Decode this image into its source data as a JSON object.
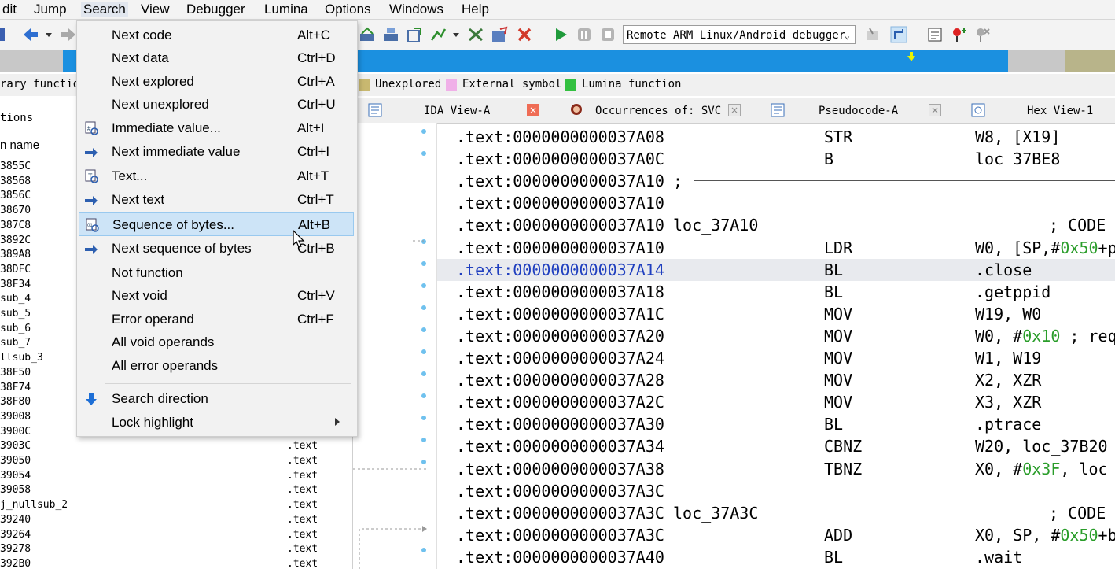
{
  "menubar": [
    "dit",
    "Jump",
    "Search",
    "View",
    "Debugger",
    "Lumina",
    "Options",
    "Windows",
    "Help"
  ],
  "toolbar": {
    "debugger": "Remote ARM Linux/Android debugger"
  },
  "legend": [
    {
      "label": "Unexplored",
      "color": "#c8b870"
    },
    {
      "label": "External symbol",
      "color": "#f0b0e8"
    },
    {
      "label": "Lumina function",
      "color": "#33c040"
    }
  ],
  "left_panel": {
    "title_partial": "rary functio",
    "header_partial": "tions",
    "column_name": "n name",
    "rows": [
      {
        "name": "3855C",
        "seg": ""
      },
      {
        "name": "38568",
        "seg": ""
      },
      {
        "name": "3856C",
        "seg": ""
      },
      {
        "name": "38670",
        "seg": ""
      },
      {
        "name": "387C8",
        "seg": ""
      },
      {
        "name": "3892C",
        "seg": ""
      },
      {
        "name": "389A8",
        "seg": ""
      },
      {
        "name": "38DFC",
        "seg": ""
      },
      {
        "name": "38F34",
        "seg": ""
      },
      {
        "name": "sub_4",
        "seg": ""
      },
      {
        "name": "sub_5",
        "seg": ""
      },
      {
        "name": "sub_6",
        "seg": ""
      },
      {
        "name": "sub_7",
        "seg": ""
      },
      {
        "name": "llsub_3",
        "seg": ""
      },
      {
        "name": "38F50",
        "seg": ""
      },
      {
        "name": "38F74",
        "seg": ""
      },
      {
        "name": "38F80",
        "seg": ""
      },
      {
        "name": "39008",
        "seg": ""
      },
      {
        "name": "3900C",
        "seg": ""
      },
      {
        "name": "3903C",
        "seg": ".text"
      },
      {
        "name": "39050",
        "seg": ".text"
      },
      {
        "name": "39054",
        "seg": ".text"
      },
      {
        "name": "39058",
        "seg": ".text"
      },
      {
        "name": "j_nullsub_2",
        "seg": ".text"
      },
      {
        "name": "39240",
        "seg": ".text"
      },
      {
        "name": "39264",
        "seg": ".text"
      },
      {
        "name": "39278",
        "seg": ".text"
      },
      {
        "name": "392B0",
        "seg": ".text"
      }
    ]
  },
  "tabs": [
    {
      "label": "IDA View-A"
    },
    {
      "label": "Occurrences of: SVC"
    },
    {
      "label": "Pseudocode-A"
    },
    {
      "label": "Hex View-1"
    }
  ],
  "search_menu": {
    "items": [
      {
        "label": "Next code",
        "shortcut": "Alt+C",
        "icon": ""
      },
      {
        "label": "Next data",
        "shortcut": "Ctrl+D",
        "icon": ""
      },
      {
        "label": "Next explored",
        "shortcut": "Ctrl+A",
        "icon": ""
      },
      {
        "label": "Next unexplored",
        "shortcut": "Ctrl+U",
        "icon": ""
      },
      {
        "label": "Immediate value...",
        "shortcut": "Alt+I",
        "icon": "immediate-value-icon"
      },
      {
        "label": "Next immediate value",
        "shortcut": "Ctrl+I",
        "icon": "next-immediate-icon"
      },
      {
        "label": "Text...",
        "shortcut": "Alt+T",
        "icon": "text-search-icon"
      },
      {
        "label": "Next text",
        "shortcut": "Ctrl+T",
        "icon": "next-text-icon"
      },
      {
        "label": "Sequence of bytes...",
        "shortcut": "Alt+B",
        "icon": "byte-sequence-icon",
        "selected": true
      },
      {
        "label": "Next sequence of bytes",
        "shortcut": "Ctrl+B",
        "icon": "next-byte-sequence-icon"
      },
      {
        "label": "Not function",
        "shortcut": "",
        "icon": ""
      },
      {
        "label": "Next void",
        "shortcut": "Ctrl+V",
        "icon": ""
      },
      {
        "label": "Error operand",
        "shortcut": "Ctrl+F",
        "icon": ""
      },
      {
        "label": "All void operands",
        "shortcut": "",
        "icon": ""
      },
      {
        "label": "All error operands",
        "shortcut": "",
        "icon": ""
      }
    ],
    "extra": [
      {
        "label": "Search direction",
        "icon": "arrow-down-icon"
      },
      {
        "label": "Lock highlight",
        "submenu": true
      }
    ]
  },
  "disasm": [
    {
      "addr": ".text:0000000000037A08",
      "label": "",
      "mnem": "STR",
      "ops": "W8, [X19]"
    },
    {
      "addr": ".text:0000000000037A0C",
      "label": "",
      "mnem": "B",
      "ops": "loc_37BE8"
    },
    {
      "addr": ".text:0000000000037A10",
      "label": ";",
      "mnem": "",
      "ops": "",
      "separator": true
    },
    {
      "addr": ".text:0000000000037A10",
      "label": "",
      "mnem": "",
      "ops": ""
    },
    {
      "addr": ".text:0000000000037A10",
      "label": "loc_37A10",
      "mnem": "",
      "ops": "",
      "comment": "; CODE"
    },
    {
      "addr": ".text:0000000000037A10",
      "label": "",
      "mnem": "LDR",
      "ops": "W0, [SP,#0x50+p"
    },
    {
      "addr": ".text:0000000000037A14",
      "label": "",
      "mnem": "BL",
      "ops": ".close",
      "highlight": true
    },
    {
      "addr": ".text:0000000000037A18",
      "label": "",
      "mnem": "BL",
      "ops": ".getppid"
    },
    {
      "addr": ".text:0000000000037A1C",
      "label": "",
      "mnem": "MOV",
      "ops": "W19, W0"
    },
    {
      "addr": ".text:0000000000037A20",
      "label": "",
      "mnem": "MOV",
      "ops": "W0, #0x10 ; req"
    },
    {
      "addr": ".text:0000000000037A24",
      "label": "",
      "mnem": "MOV",
      "ops": "W1, W19"
    },
    {
      "addr": ".text:0000000000037A28",
      "label": "",
      "mnem": "MOV",
      "ops": "X2, XZR"
    },
    {
      "addr": ".text:0000000000037A2C",
      "label": "",
      "mnem": "MOV",
      "ops": "X3, XZR"
    },
    {
      "addr": ".text:0000000000037A30",
      "label": "",
      "mnem": "BL",
      "ops": ".ptrace"
    },
    {
      "addr": ".text:0000000000037A34",
      "label": "",
      "mnem": "CBNZ",
      "ops": "W20, loc_37B20"
    },
    {
      "addr": ".text:0000000000037A38",
      "label": "",
      "mnem": "TBNZ",
      "ops": "X0, #0x3F, loc_"
    },
    {
      "addr": ".text:0000000000037A3C",
      "label": "",
      "mnem": "",
      "ops": ""
    },
    {
      "addr": ".text:0000000000037A3C",
      "label": "loc_37A3C",
      "mnem": "",
      "ops": "",
      "comment": "; CODE"
    },
    {
      "addr": ".text:0000000000037A3C",
      "label": "",
      "mnem": "ADD",
      "ops": "X0, SP, #0x50+b"
    },
    {
      "addr": ".text:0000000000037A40",
      "label": "",
      "mnem": "BL",
      "ops": ".wait"
    }
  ]
}
